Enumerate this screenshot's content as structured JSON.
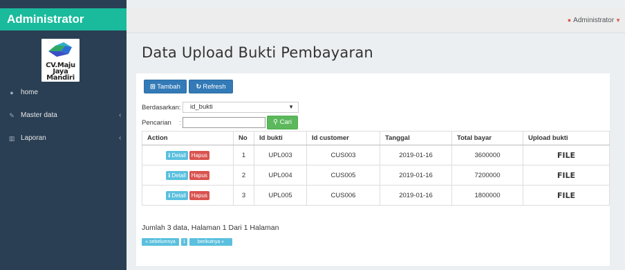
{
  "sidebar": {
    "brand": "Administrator",
    "logo_text": "CV.Maju\nJaya Mandiri",
    "items": [
      {
        "label": "home",
        "icon": "dashboard-icon"
      },
      {
        "label": "Master data",
        "icon": "edit-icon",
        "has_children": true
      },
      {
        "label": "Laporan",
        "icon": "chart-icon",
        "has_children": true
      }
    ]
  },
  "topbar": {
    "user": "Administrator"
  },
  "page": {
    "title": "Data Upload Bukti Pembayaran"
  },
  "toolbar": {
    "add_label": "Tambah",
    "refresh_label": "Refresh"
  },
  "filter": {
    "by_label": "Berdasarkan:",
    "by_value": "id_bukti",
    "search_label": "Pencarian",
    "search_value": "",
    "search_button": "Cari"
  },
  "table": {
    "headers": [
      "Action",
      "No",
      "Id bukti",
      "Id customer",
      "Tanggal",
      "Total bayar",
      "Upload bukti"
    ],
    "detail_label": "Detail",
    "delete_label": "Hapus",
    "rows": [
      {
        "no": "1",
        "id_bukti": "UPL003",
        "id_customer": "CUS003",
        "tanggal": "2019-01-16",
        "total": "3600000",
        "upload": "FILE"
      },
      {
        "no": "2",
        "id_bukti": "UPL004",
        "id_customer": "CUS005",
        "tanggal": "2019-01-16",
        "total": "7200000",
        "upload": "FILE"
      },
      {
        "no": "3",
        "id_bukti": "UPL005",
        "id_customer": "CUS006",
        "tanggal": "2019-01-16",
        "total": "1800000",
        "upload": "FILE"
      }
    ]
  },
  "summary": "Jumlah 3 data, Halaman 1 Dari 1 Halaman",
  "pagination": {
    "prev": "« sebelumnya",
    "page": "1",
    "next": "berikutnya »"
  },
  "colors": {
    "sidebar": "#2a3f54",
    "brand": "#1abb9c",
    "primary": "#337ab7",
    "success": "#5cb85c",
    "info": "#5bc0de",
    "danger": "#d9534f"
  }
}
